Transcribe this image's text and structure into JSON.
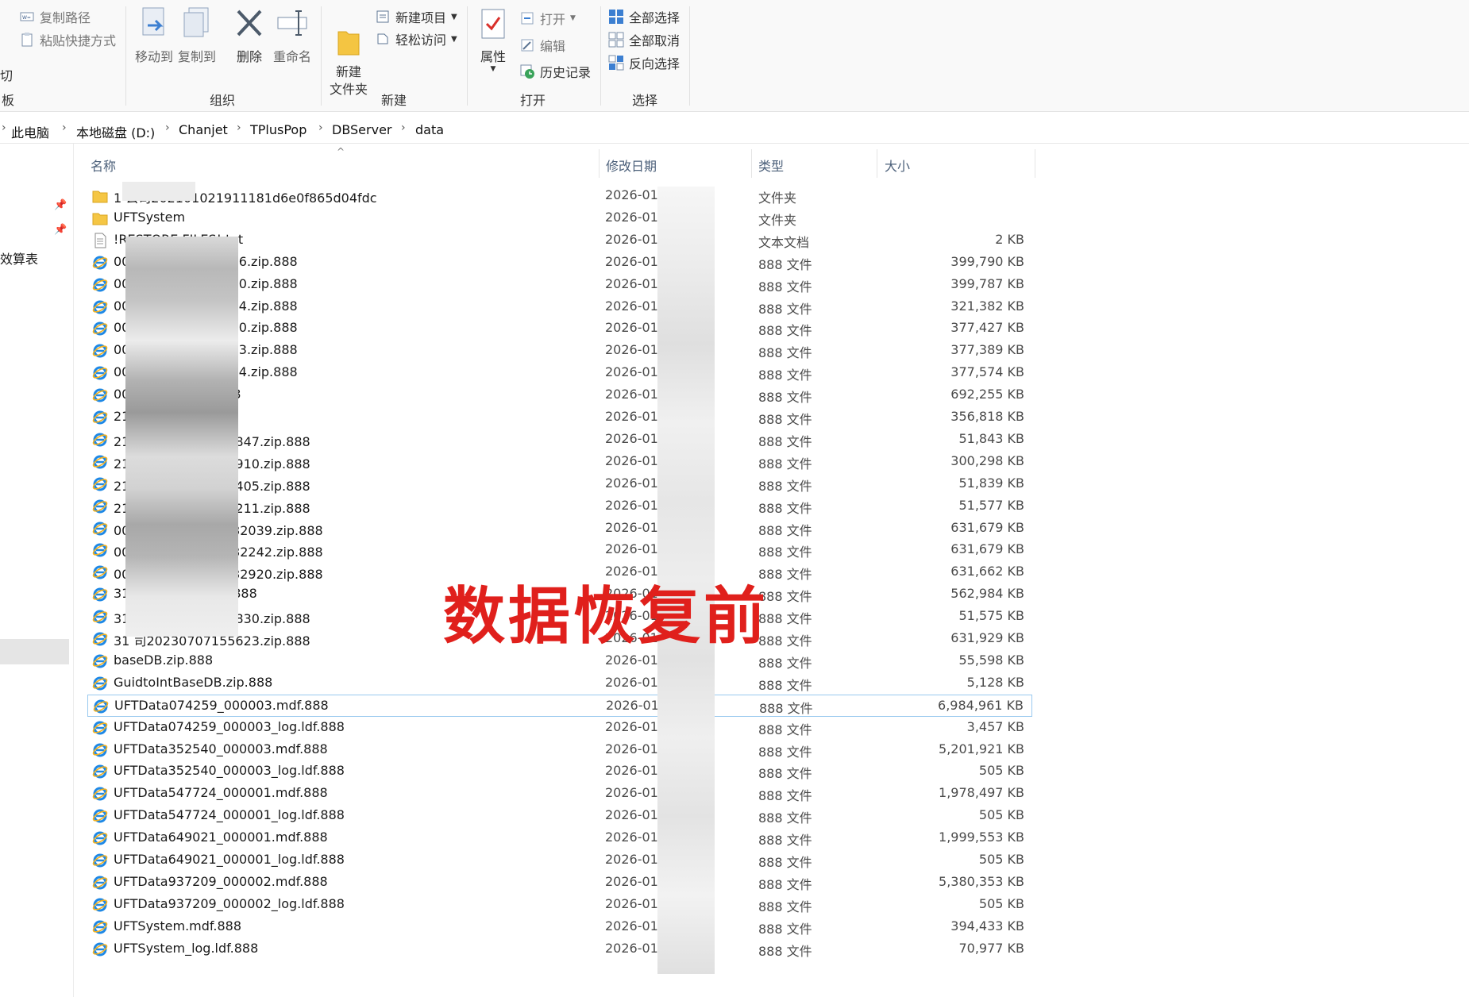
{
  "ribbon": {
    "clipboard": {
      "copy_path": "复制路径",
      "paste_shortcut": "粘贴快捷方式",
      "cut_partial": "切",
      "label_partial": "板"
    },
    "organize": {
      "move_to": "移动到",
      "copy_to": "复制到",
      "delete": "删除",
      "rename": "重命名",
      "label": "组织"
    },
    "new": {
      "new_item": "新建项目",
      "easy_access": "轻松访问",
      "new_folder": "新建\n文件夹",
      "label": "新建"
    },
    "open": {
      "properties": "属性",
      "open": "打开",
      "edit": "编辑",
      "history": "历史记录",
      "label": "打开"
    },
    "select": {
      "select_all": "全部选择",
      "select_none": "全部取消",
      "invert": "反向选择",
      "label": "选择"
    }
  },
  "address": {
    "crumbs": [
      "此电脑",
      "本地磁盘 (D:)",
      "Chanjet",
      "TPlusPop",
      "DBServer",
      "data"
    ]
  },
  "nav": {
    "partial_item": "效算表"
  },
  "columns": {
    "name": "名称",
    "date": "修改日期",
    "type": "类型",
    "size": "大小"
  },
  "files": [
    {
      "icon": "folder",
      "name": "1              公司202101021911181d6e0f865d04fdc",
      "date": "2026-01",
      "type": "文件夹",
      "size": ""
    },
    {
      "icon": "folder",
      "name": "UFTSystem",
      "date": "2026-01",
      "type": "文件夹",
      "size": ""
    },
    {
      "icon": "txt",
      "name": "!RESTORE FILES!.txt",
      "date": "2026-01",
      "type": "文本文档",
      "size": "2 KB"
    },
    {
      "icon": "ie",
      "name": "00                              20210102192016.zip.888",
      "date": "2026-01",
      "type": "888 文件",
      "size": "399,790 KB"
    },
    {
      "icon": "ie",
      "name": "00                              20210102205740.zip.888",
      "date": "2026-01",
      "type": "888 文件",
      "size": "399,787 KB"
    },
    {
      "icon": "ie",
      "name": "00                              20210102225254.zip.888",
      "date": "2026-01",
      "type": "888 文件",
      "size": "321,382 KB"
    },
    {
      "icon": "ie",
      "name": "00                              20260110232910.zip.888",
      "date": "2026-01",
      "type": "888 文件",
      "size": "377,427 KB"
    },
    {
      "icon": "ie",
      "name": "00                              20260111232913.zip.888",
      "date": "2026-01",
      "type": "888 文件",
      "size": "377,389 KB"
    },
    {
      "icon": "ie",
      "name": "00                              20260112232914.zip.888",
      "date": "2026-01",
      "type": "888 文件",
      "size": "377,574 KB"
    },
    {
      "icon": "ie",
      "name": "00                              8224337.zip.888",
      "date": "2026-01",
      "type": "888 文件",
      "size": "692,255 KB"
    },
    {
      "icon": "ie",
      "name": "21                              00846.zip.888",
      "date": "2026-01",
      "type": "888 文件",
      "size": "356,818 KB"
    },
    {
      "icon": "ie",
      "name": "21                              司20210102191847.zip.888",
      "date": "2026-01",
      "type": "888 文件",
      "size": "51,843 KB"
    },
    {
      "icon": "ie",
      "name": "21                              司20210102202910.zip.888",
      "date": "2026-01",
      "type": "888 文件",
      "size": "300,298 KB"
    },
    {
      "icon": "ie",
      "name": "21                              司20210102203405.zip.888",
      "date": "2026-01",
      "type": "888 文件",
      "size": "51,839 KB"
    },
    {
      "icon": "ie",
      "name": "21                              司20210102223211.zip.888",
      "date": "2026-01",
      "type": "888 文件",
      "size": "51,577 KB"
    },
    {
      "icon": "ie",
      "name": "00                              公司20230704232039.zip.888",
      "date": "2026-01",
      "type": "888 文件",
      "size": "631,679 KB"
    },
    {
      "icon": "ie",
      "name": "00                              公司20230705232242.zip.888",
      "date": "2026-01",
      "type": "888 文件",
      "size": "631,679 KB"
    },
    {
      "icon": "ie",
      "name": "00                              公司20230706232920.zip.888",
      "date": "2026-01",
      "type": "888 文件",
      "size": "631,662 KB"
    },
    {
      "icon": "ie",
      "name": "31                              007091856.zip.888",
      "date": "2026-01",
      "type": "888 文件",
      "size": "562,984 KB"
    },
    {
      "icon": "ie",
      "name": "31                              司20210102202830.zip.888",
      "date": "2026-01",
      "type": "888 文件",
      "size": "51,575 KB"
    },
    {
      "icon": "ie",
      "name": "31                              司20230707155623.zip.888",
      "date": "2026-01",
      "type": "888 文件",
      "size": "631,929 KB"
    },
    {
      "icon": "ie",
      "name": "baseDB.zip.888",
      "date": "2026-01",
      "type": "888 文件",
      "size": "55,598 KB"
    },
    {
      "icon": "ie",
      "name": "GuidtoIntBaseDB.zip.888",
      "date": "2026-01",
      "type": "888 文件",
      "size": "5,128 KB"
    },
    {
      "icon": "ie",
      "name": "UFTData074259_000003.mdf.888",
      "date": "2026-01",
      "type": "888 文件",
      "size": "6,984,961 KB",
      "selected": true
    },
    {
      "icon": "ie",
      "name": "UFTData074259_000003_log.ldf.888",
      "date": "2026-01",
      "type": "888 文件",
      "size": "3,457 KB"
    },
    {
      "icon": "ie",
      "name": "UFTData352540_000003.mdf.888",
      "date": "2026-01",
      "type": "888 文件",
      "size": "5,201,921 KB"
    },
    {
      "icon": "ie",
      "name": "UFTData352540_000003_log.ldf.888",
      "date": "2026-01",
      "type": "888 文件",
      "size": "505 KB"
    },
    {
      "icon": "ie",
      "name": "UFTData547724_000001.mdf.888",
      "date": "2026-01",
      "type": "888 文件",
      "size": "1,978,497 KB"
    },
    {
      "icon": "ie",
      "name": "UFTData547724_000001_log.ldf.888",
      "date": "2026-01",
      "type": "888 文件",
      "size": "505 KB"
    },
    {
      "icon": "ie",
      "name": "UFTData649021_000001.mdf.888",
      "date": "2026-01",
      "type": "888 文件",
      "size": "1,999,553 KB"
    },
    {
      "icon": "ie",
      "name": "UFTData649021_000001_log.ldf.888",
      "date": "2026-01",
      "type": "888 文件",
      "size": "505 KB"
    },
    {
      "icon": "ie",
      "name": "UFTData937209_000002.mdf.888",
      "date": "2026-01",
      "type": "888 文件",
      "size": "5,380,353 KB"
    },
    {
      "icon": "ie",
      "name": "UFTData937209_000002_log.ldf.888",
      "date": "2026-01",
      "type": "888 文件",
      "size": "505 KB"
    },
    {
      "icon": "ie",
      "name": "UFTSystem.mdf.888",
      "date": "2026-01",
      "type": "888 文件",
      "size": "394,433 KB"
    },
    {
      "icon": "ie",
      "name": "UFTSystem_log.ldf.888",
      "date": "2026-01",
      "type": "888 文件",
      "size": "70,977 KB"
    }
  ],
  "overlay": {
    "text": "数据恢复前"
  }
}
